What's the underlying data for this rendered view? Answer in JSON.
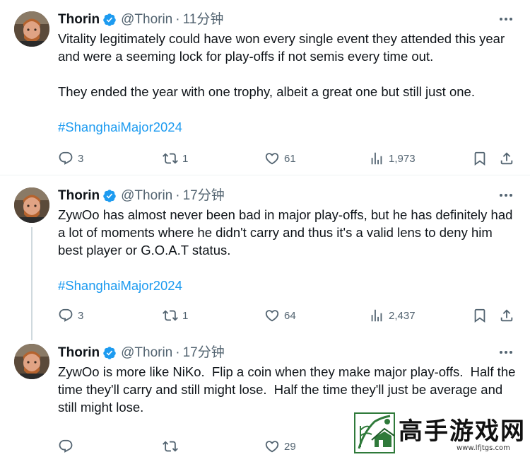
{
  "tweets": [
    {
      "name": "Thorin",
      "handle": "@Thorin",
      "time": "11分钟",
      "paragraphs": [
        "Vitality legitimately could have won every single event they attended this year and were a seeming lock for play-offs if not semis every time out.",
        "They ended the year with one trophy, albeit a great one but still just one."
      ],
      "hashtag": "#ShanghaiMajor2024",
      "replies": "3",
      "retweets": "1",
      "likes": "61",
      "views": "1,973"
    },
    {
      "name": "Thorin",
      "handle": "@Thorin",
      "time": "17分钟",
      "paragraphs": [
        "ZywOo has almost never been bad in major play-offs, but he has definitely had a lot of moments where he didn't carry and thus it's a valid lens to deny him best player or G.O.A.T status."
      ],
      "hashtag": "#ShanghaiMajor2024",
      "replies": "3",
      "retweets": "1",
      "likes": "64",
      "views": "2,437"
    },
    {
      "name": "Thorin",
      "handle": "@Thorin",
      "time": "17分钟",
      "paragraphs": [
        "ZywOo is more like NiKo.  Flip a coin when they make major play-offs.  Half the time they'll carry and still might lose.  Half the time they'll just be average and still might lose."
      ],
      "likes": "29"
    }
  ],
  "watermark": {
    "title": "高手游戏网",
    "url": "www.lfjtgs.com"
  },
  "colors": {
    "accent": "#1d9bf0",
    "secondary_text": "#536471",
    "verified": "#1d9bf0"
  },
  "icons": [
    "reply-icon",
    "retweet-icon",
    "like-icon",
    "views-icon",
    "bookmark-icon",
    "share-icon",
    "more-icon",
    "verified-badge-icon"
  ]
}
